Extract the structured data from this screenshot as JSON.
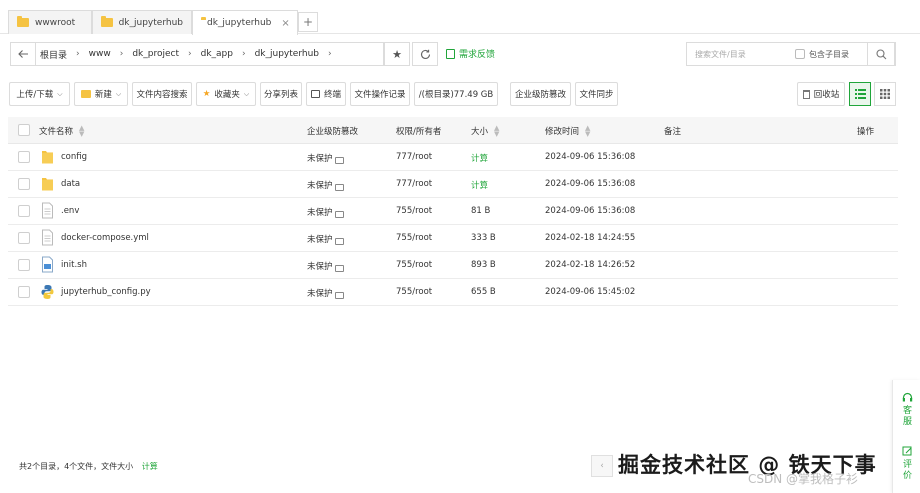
{
  "tabs": [
    {
      "label": "wwwroot"
    },
    {
      "label": "dk_jupyterhub"
    },
    {
      "label": "dk_jupyterhub"
    }
  ],
  "tab_add": "+",
  "tab_close": "×",
  "address": {
    "crumbs": [
      "根目录",
      "www",
      "dk_project",
      "dk_app",
      "dk_jupyterhub"
    ],
    "feedback": "需求反馈",
    "search_placeholder": "搜索文件/目录",
    "include_sub": "包含子目录"
  },
  "toolbar": {
    "upload": "上传/下载",
    "new": "新建",
    "content_search": "文件内容搜索",
    "favorites": "收藏夹",
    "share_list": "分享列表",
    "terminal": "终端",
    "op_log": "文件操作记录",
    "disk": "/(根目录)77.49 GB",
    "tamper": "企业级防篡改",
    "sync": "文件同步",
    "recycle": "回收站"
  },
  "table": {
    "headers": {
      "name": "文件名称",
      "protect": "企业级防篡改",
      "perm": "权限/所有者",
      "size": "大小",
      "mtime": "修改时间",
      "note": "备注",
      "ops": "操作"
    },
    "rows": [
      {
        "name": "config",
        "protect": "未保护",
        "perm": "777/root",
        "size": "计算",
        "mtime": "2024-09-06 15:36:08",
        "type": "folder"
      },
      {
        "name": "data",
        "protect": "未保护",
        "perm": "777/root",
        "size": "计算",
        "mtime": "2024-09-06 15:36:08",
        "type": "folder"
      },
      {
        "name": ".env",
        "protect": "未保护",
        "perm": "755/root",
        "size": "81 B",
        "mtime": "2024-09-06 15:36:08",
        "type": "file"
      },
      {
        "name": "docker-compose.yml",
        "protect": "未保护",
        "perm": "755/root",
        "size": "333 B",
        "mtime": "2024-02-18 14:24:55",
        "type": "file"
      },
      {
        "name": "init.sh",
        "protect": "未保护",
        "perm": "755/root",
        "size": "893 B",
        "mtime": "2024-02-18 14:26:52",
        "type": "shell"
      },
      {
        "name": "jupyterhub_config.py",
        "protect": "未保护",
        "perm": "755/root",
        "size": "655 B",
        "mtime": "2024-09-06 15:45:02",
        "type": "python"
      }
    ]
  },
  "footer": {
    "summary": "共2个目录，4个文件，文件大小",
    "calc": "计算"
  },
  "watermark": {
    "main": "掘金技术社区 @ 铁天下事",
    "sub": "CSDN @掌我格子衫"
  },
  "side_panel": {
    "service": "客服",
    "review": "评价"
  },
  "colors": {
    "accent": "#20a53a",
    "folder": "#f5c342"
  }
}
